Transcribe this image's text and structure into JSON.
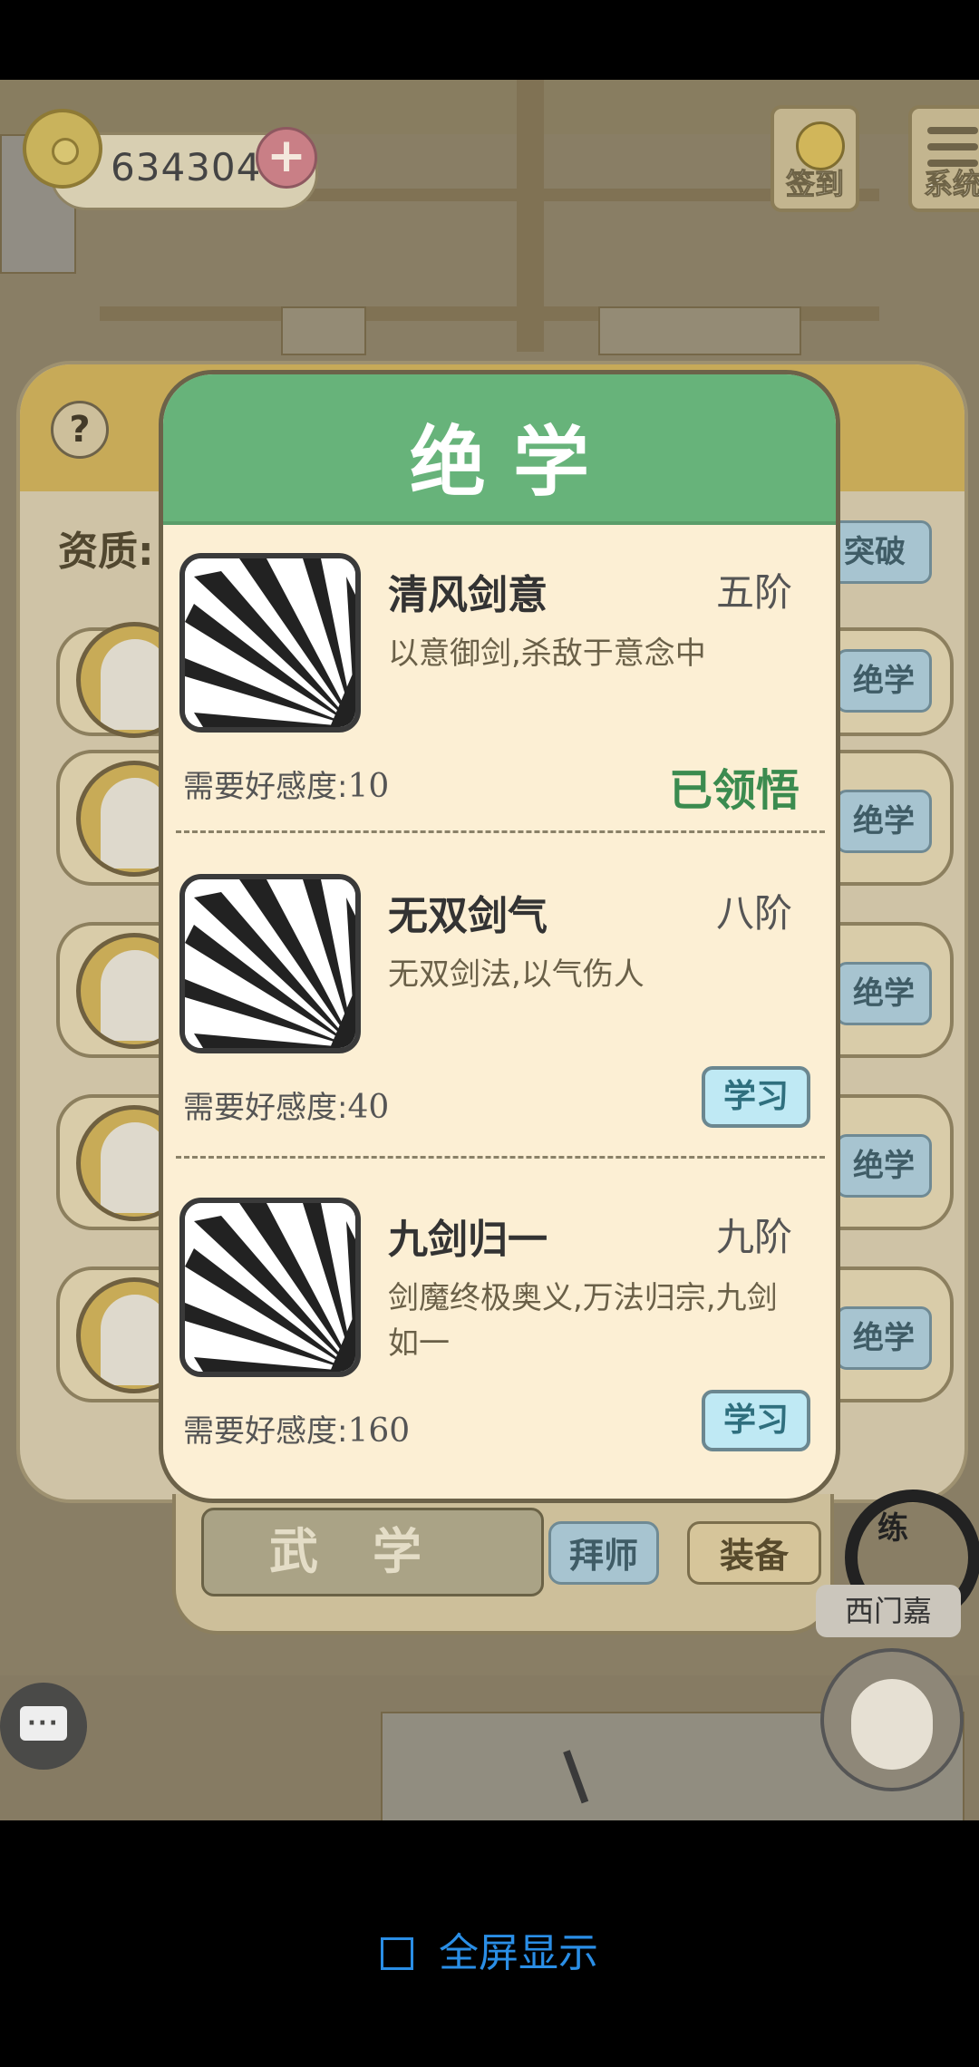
{
  "top_bar": {
    "coins": "634304",
    "checkin_label": "签到",
    "system_label": "系统"
  },
  "background": {
    "aptitude_label": "资质:",
    "breakthrough_label": "突破",
    "row_button_label": "绝学",
    "tabs": {
      "martial_arts": "武学",
      "apprentice": "拜师",
      "equip": "装备"
    },
    "npc_name": "西门嘉",
    "brush_char": "练"
  },
  "modal": {
    "title": "绝学",
    "skills": [
      {
        "name": "清风剑意",
        "rank": "五阶",
        "description": "以意御剑,杀敌于意念中",
        "requirement_label": "需要好感度:",
        "requirement_value": "10",
        "status": "已领悟"
      },
      {
        "name": "无双剑气",
        "rank": "八阶",
        "description": "无双剑法,以气伤人",
        "requirement_label": "需要好感度:",
        "requirement_value": "40",
        "button": "学习"
      },
      {
        "name": "九剑归一",
        "rank": "九阶",
        "description": "剑魔终极奥义,万法归宗,九剑如一",
        "requirement_label": "需要好感度:",
        "requirement_value": "160",
        "button": "学习"
      }
    ]
  },
  "nav": {
    "fullscreen_label": "全屏显示"
  },
  "colors": {
    "modal_header": "#67b37a",
    "learned_text": "#3b8b4f",
    "learn_button": "#bfe9f4",
    "link_blue": "#2a8ee6"
  }
}
